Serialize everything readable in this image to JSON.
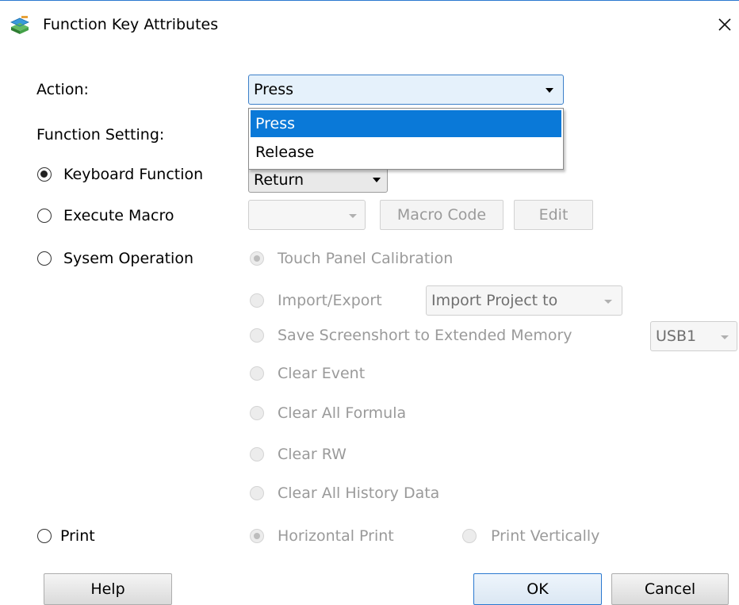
{
  "window": {
    "title": "Function Key Attributes",
    "icon": "app-layers-icon",
    "close_icon": "close-icon"
  },
  "action": {
    "label": "Action:",
    "value": "Press",
    "options": [
      "Press",
      "Release"
    ],
    "highlighted_option": "Press"
  },
  "function_setting": {
    "label": "Function Setting:"
  },
  "keyboard_function": {
    "label": "Keyboard Function",
    "checked": true,
    "value": "Return"
  },
  "execute_macro": {
    "label": "Execute Macro",
    "checked": false,
    "value": "",
    "macro_code_label": "Macro Code",
    "edit_label": "Edit"
  },
  "system_operation": {
    "label": "Sysem Operation",
    "checked": false,
    "options": [
      {
        "label": "Touch Panel Calibration",
        "checked": true
      },
      {
        "label": "Import/Export",
        "checked": false,
        "select_value": "Import Project to"
      },
      {
        "label": "Save Screenshort to Extended Memory",
        "checked": false,
        "select_value": "USB1"
      },
      {
        "label": "Clear Event",
        "checked": false
      },
      {
        "label": "Clear All Formula",
        "checked": false
      },
      {
        "label": "Clear RW",
        "checked": false
      },
      {
        "label": "Clear All History Data",
        "checked": false
      }
    ]
  },
  "print": {
    "label": "Print",
    "checked": false,
    "options": [
      {
        "label": "Horizontal Print",
        "checked": true
      },
      {
        "label": "Print Vertically",
        "checked": false
      }
    ]
  },
  "buttons": {
    "help": "Help",
    "ok": "OK",
    "cancel": "Cancel"
  },
  "colors": {
    "accent": "#0a79d8",
    "focus_border": "#3c7fc9",
    "disabled_text": "#9a9a9a"
  }
}
